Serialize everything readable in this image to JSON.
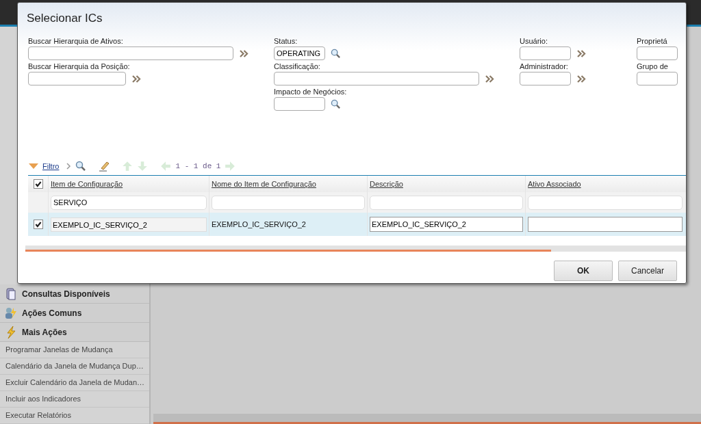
{
  "sidebar": {
    "sections": [
      {
        "label": "Consultas Disponíveis",
        "kind": "queries"
      },
      {
        "label": "Ações Comuns",
        "kind": "common"
      },
      {
        "label": "Mais Ações",
        "kind": "more"
      }
    ],
    "links": [
      "Programar Janelas de Mudança",
      "Calendário da Janela de Mudança Dup…",
      "Excluir Calendário da Janela de Mudan…",
      "Incluir aos Indicadores",
      "Executar Relatórios"
    ]
  },
  "dialog": {
    "title": "Selecionar ICs",
    "filter_columns": [
      [
        {
          "label": "Buscar Hierarquia de Ativos:",
          "kind": "hierarchy"
        },
        {
          "label": "Buscar Hierarquia da Posição:",
          "kind": "hierarchy"
        }
      ],
      [
        {
          "label": "Status:",
          "value": "OPERATING",
          "kind": "lookup"
        },
        {
          "label": "Classificação:",
          "kind": "hierarchy"
        },
        {
          "label": "Impacto de Negócios:",
          "kind": "lookup"
        }
      ],
      [
        {
          "label": "Usuário:",
          "kind": "hierarchy"
        },
        {
          "label": "Administrador:",
          "kind": "hierarchy"
        }
      ],
      [
        {
          "label": "Proprietá",
          "kind": "plain"
        },
        {
          "label": "Grupo de",
          "kind": "plain"
        }
      ]
    ],
    "toolbar": {
      "filter_link": "Filtro",
      "pagination": "1 - 1 de 1"
    },
    "table": {
      "select_all": true,
      "columns": [
        {
          "label": "Item de Configuração",
          "kind": "readonly"
        },
        {
          "label": "Nome do Item de Configuração",
          "kind": "text"
        },
        {
          "label": "Descrição",
          "kind": "input"
        },
        {
          "label": "Ativo Associado",
          "kind": "input"
        }
      ],
      "filter_values": [
        "SERVIÇO"
      ],
      "rows": [
        {
          "checked": true,
          "selected": true,
          "cells": [
            "EXEMPLO_IC_SERVIÇO_2",
            "EXEMPLO_IC_SERVIÇO_2",
            "EXEMPLO_IC_SERVIÇO_2"
          ]
        }
      ]
    },
    "buttons": [
      {
        "label": "OK",
        "primary": true
      },
      {
        "label": "Cancelar",
        "primary": false
      }
    ]
  }
}
